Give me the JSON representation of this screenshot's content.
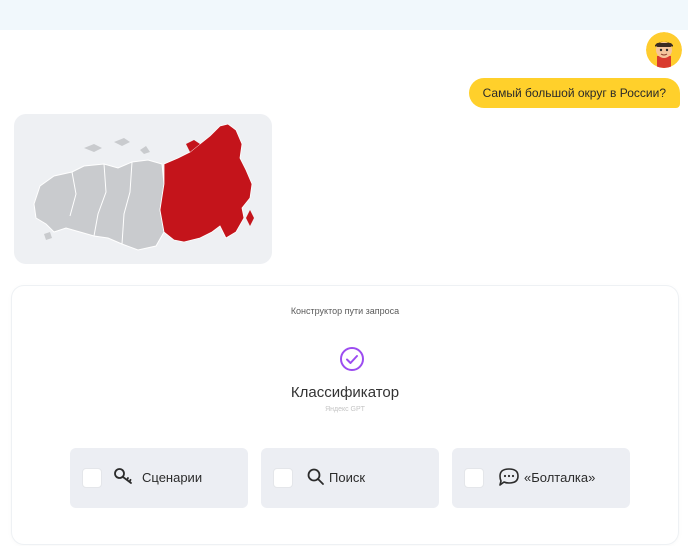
{
  "chat": {
    "user_message": "Самый большой округ в России?"
  },
  "constructor": {
    "title": "Конструктор пути запроса",
    "stage_name": "Классификатор",
    "stage_subtitle": "Яндекс GPT"
  },
  "options": [
    {
      "label": "Сценарии",
      "icon": "search-key-icon"
    },
    {
      "label": "Поиск",
      "icon": "search-icon"
    },
    {
      "label": "«Болталка»",
      "icon": "chat-bubble-icon"
    }
  ],
  "colors": {
    "accent_yellow": "#ffd02b",
    "highlight_region": "#c4141b",
    "map_gray": "#c9cbce",
    "check_purple": "#9c4cf0"
  }
}
